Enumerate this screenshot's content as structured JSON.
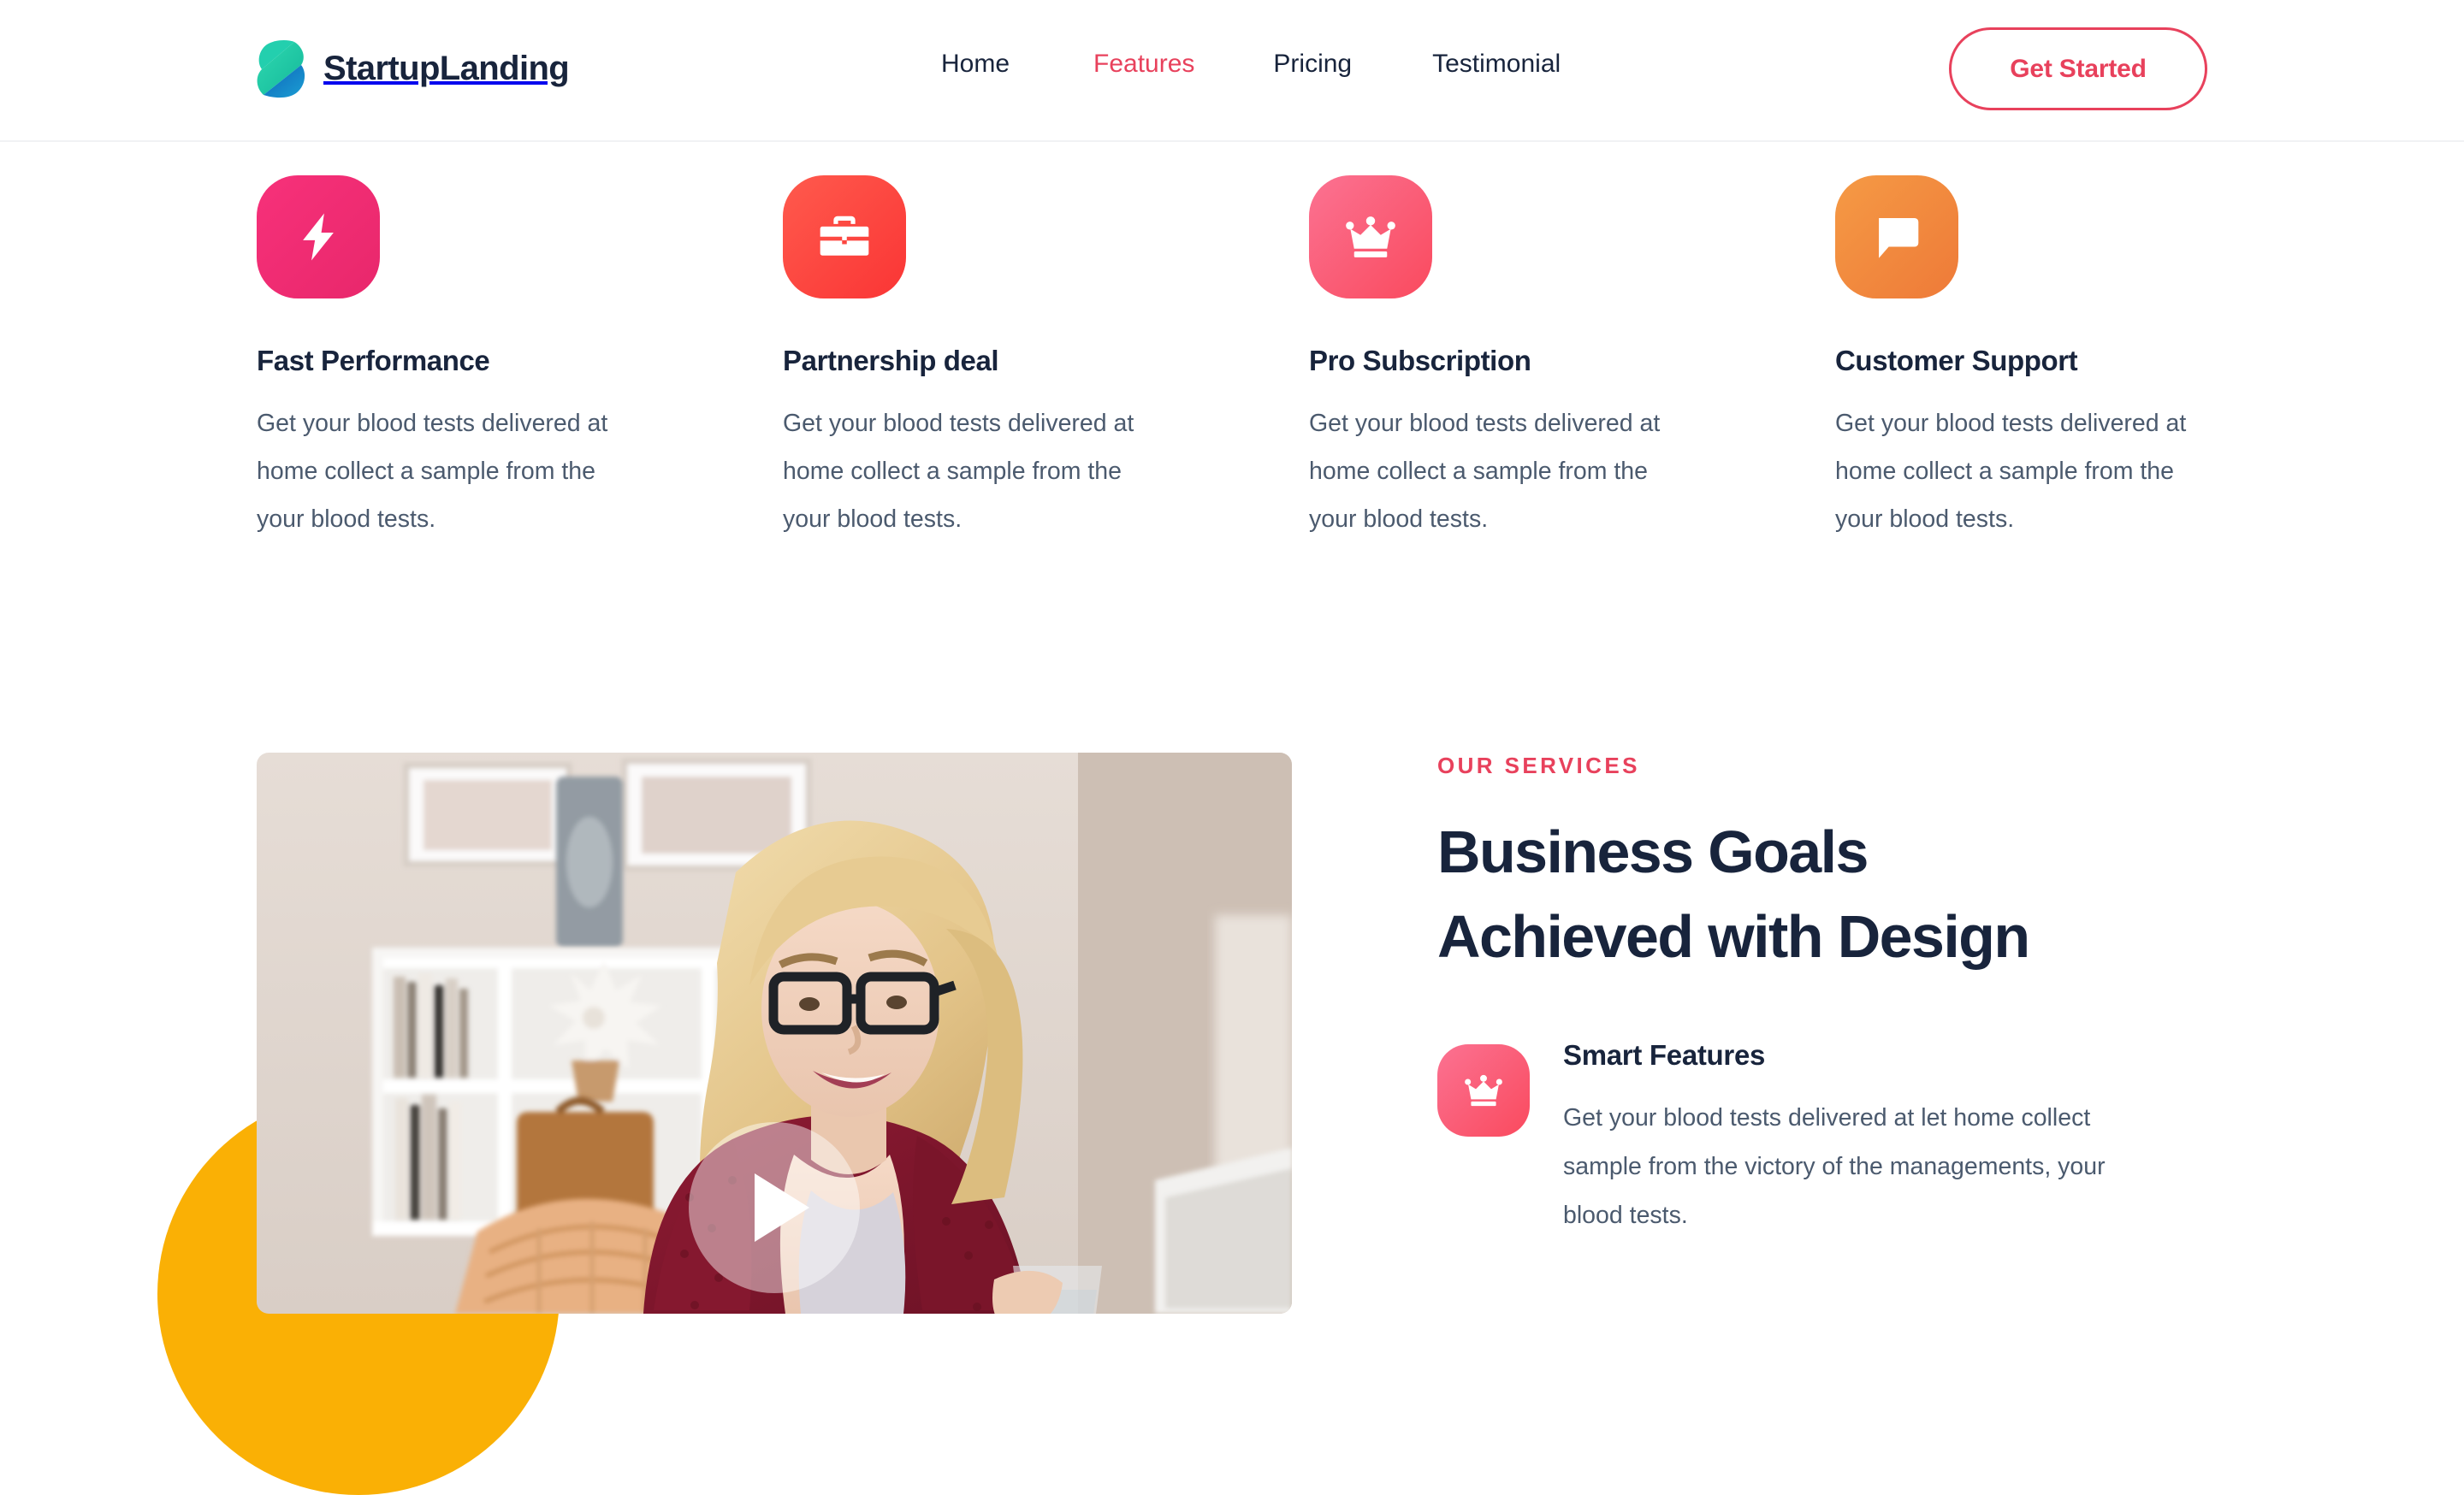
{
  "header": {
    "brand_name": "StartupLanding",
    "logo_icon": "s-mark-logo",
    "nav": [
      {
        "label": "Home",
        "active": false,
        "icon": "nav-item"
      },
      {
        "label": "Features",
        "active": true,
        "icon": "nav-item"
      },
      {
        "label": "Pricing",
        "active": false,
        "icon": "nav-item"
      },
      {
        "label": "Testimonial",
        "active": false,
        "icon": "nav-item"
      }
    ],
    "cta_label": "Get Started"
  },
  "features": [
    {
      "icon": "lightning-bolt-icon",
      "title": "Fast Performance",
      "body": "Get your blood tests delivered at home collect a sample from the your blood tests.",
      "color_start": "#f7317a",
      "color_end": "#e8276b"
    },
    {
      "icon": "briefcase-icon",
      "title": "Partnership deal",
      "body": "Get your blood tests delivered at home collect a sample from the your blood tests.",
      "color_start": "#ff5449",
      "color_end": "#fa3b3b"
    },
    {
      "icon": "crown-icon",
      "title": "Pro Subscription",
      "body": "Get your blood tests delivered at home collect a sample from the your blood tests.",
      "color_start": "#fb6a8e",
      "color_end": "#fa4f62"
    },
    {
      "icon": "chat-bubble-icon",
      "title": "Customer Support",
      "body": "Get your blood tests delivered at home collect a sample from the your blood tests.",
      "color_start": "#f2933f",
      "color_end": "#ef7f3c"
    }
  ],
  "services": {
    "eyebrow": "OUR SERVICES",
    "heading_line1": "Business Goals",
    "heading_line2": "Achieved with Design",
    "media": {
      "alt": "Smiling blonde woman with glasses in a red cardigan sitting at home",
      "play_icon": "play-triangle-icon",
      "decoration_color": "#fab005"
    },
    "items": [
      {
        "icon": "crown-icon",
        "title": "Smart Features",
        "body": "Get your blood tests delivered at let home collect sample from the victory of the managements, your blood tests.",
        "color_start": "#fb6a8e",
        "color_end": "#fa4f62"
      }
    ]
  },
  "colors": {
    "accent": "#e8415c",
    "heading": "#18243c",
    "body_text": "#4b5a6e",
    "background": "#ffffff",
    "decoration": "#fab005"
  }
}
